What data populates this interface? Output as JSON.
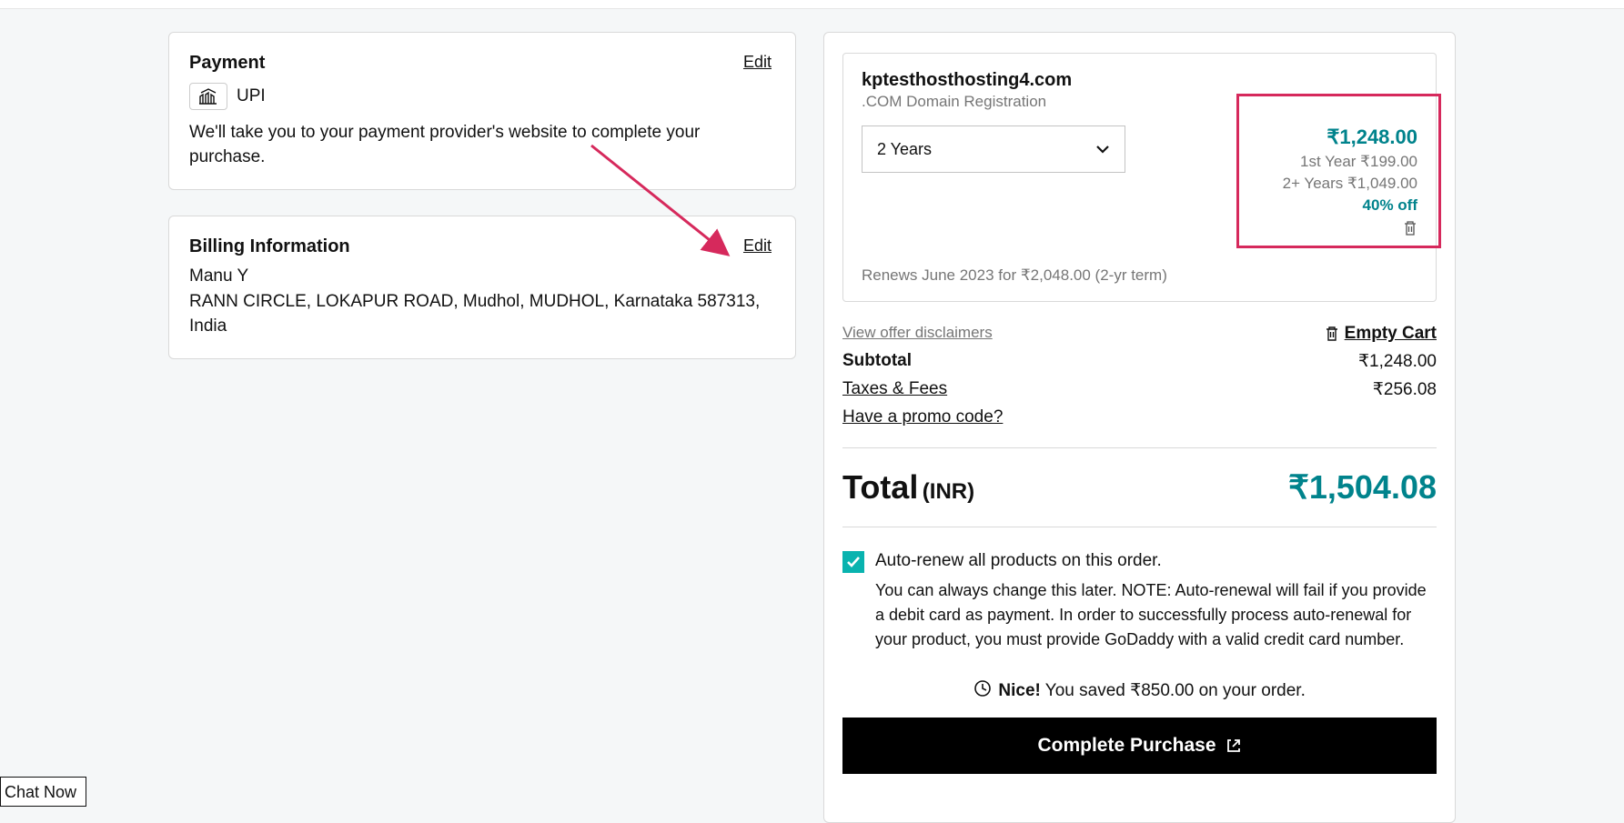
{
  "payment": {
    "title": "Payment",
    "edit": "Edit",
    "method_label": "UPI",
    "description": "We'll take you to your payment provider's website to complete your purchase."
  },
  "billing": {
    "title": "Billing Information",
    "edit": "Edit",
    "name": "Manu Y",
    "address": "RANN CIRCLE, LOKAPUR ROAD, Mudhol, MUDHOL, Karnataka 587313, India"
  },
  "product": {
    "name": "kptesthosthosting4.com",
    "subtitle": ".COM Domain Registration",
    "term_selected": "2 Years",
    "price": "₹1,248.00",
    "first_year": "1st Year ₹199.00",
    "two_plus": "2+ Years ₹1,049.00",
    "discount": "40% off",
    "renewal_note": "Renews June 2023 for ₹2,048.00 (2-yr term)"
  },
  "summary": {
    "view_disclaimers": "View offer disclaimers",
    "empty_cart": "Empty Cart",
    "subtotal_label": "Subtotal",
    "subtotal_value": "₹1,248.00",
    "taxes_label": "Taxes & Fees",
    "taxes_value": "₹256.08",
    "promo_link": "Have a promo code?",
    "total_label": "Total",
    "total_currency": "(INR)",
    "total_value": "₹1,504.08"
  },
  "auto_renew": {
    "label": "Auto-renew all products on this order.",
    "note": "You can always change this later. NOTE: Auto-renewal will fail if you provide a debit card as payment. In order to successfully process auto-renewal for your product, you must provide GoDaddy with a valid credit card number."
  },
  "nice": {
    "prefix": "Nice!",
    "text": " You saved ₹850.00 on your order."
  },
  "complete_button": "Complete Purchase",
  "chat_now": "Chat Now"
}
